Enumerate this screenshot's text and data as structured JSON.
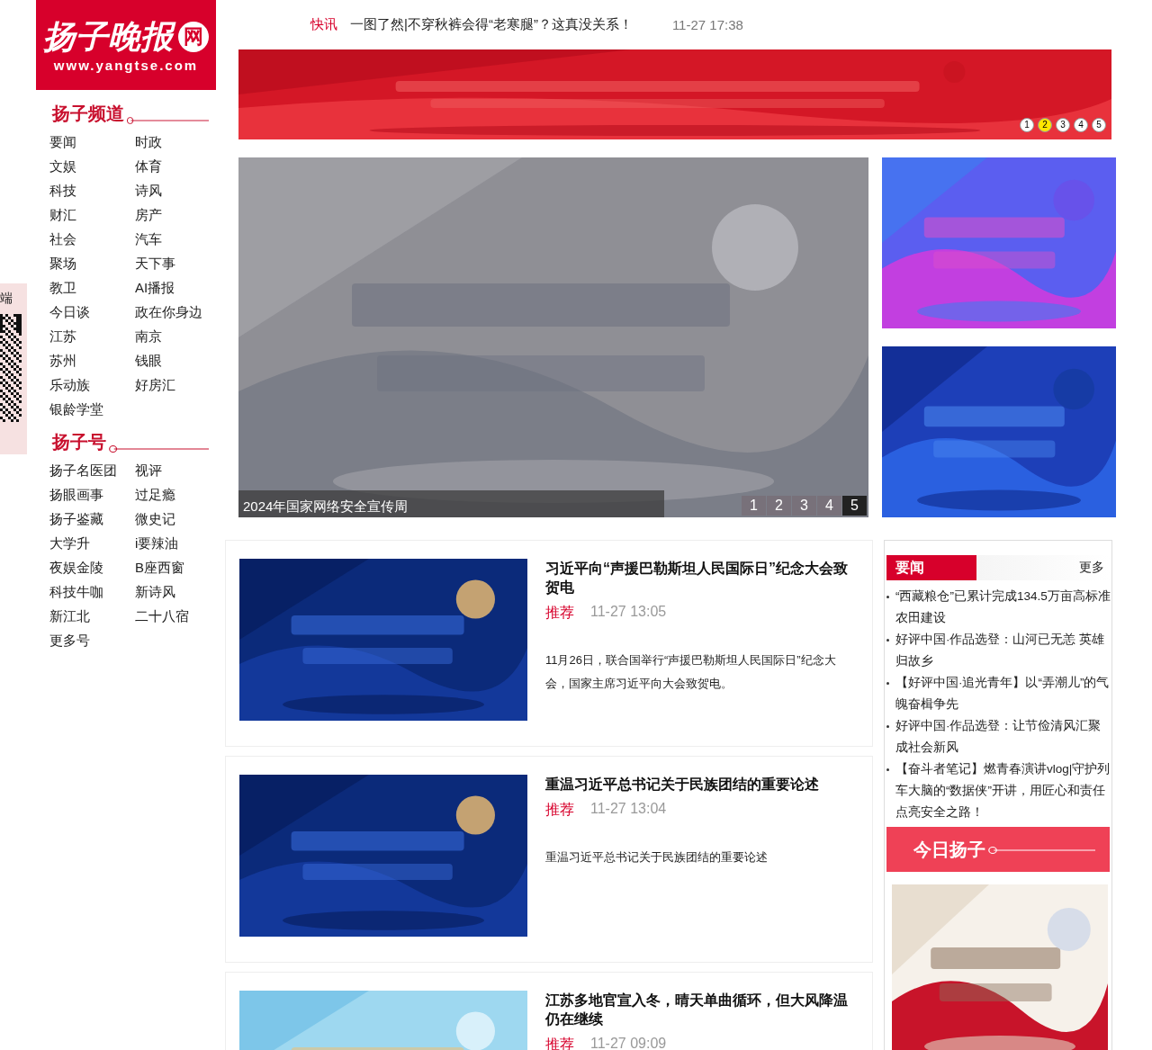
{
  "logo": {
    "name": "扬子晚报",
    "badge": "网",
    "url": "www.yangtse.com"
  },
  "side_qr": {
    "label": "端"
  },
  "channels": {
    "title": "扬子频道",
    "items": [
      "要闻",
      "时政",
      "文娱",
      "体育",
      "科技",
      "诗风",
      "财汇",
      "房产",
      "社会",
      "汽车",
      "聚场",
      "天下事",
      "教卫",
      "AI播报",
      "今日谈",
      "政在你身边",
      "江苏",
      "南京",
      "苏州",
      "钱眼",
      "乐动族",
      "好房汇",
      "银龄学堂"
    ]
  },
  "accounts": {
    "title": "扬子号",
    "items": [
      "扬子名医团",
      "视评",
      "扬眼画事",
      "过足瘾",
      "扬子鉴藏",
      "微史记",
      "大学升",
      "i要辣油",
      "夜娱金陵",
      "B座西窗",
      "科技牛咖",
      "新诗风",
      "新江北",
      "二十八宿",
      "更多号"
    ]
  },
  "ticker": {
    "tag": "快讯",
    "headline": "一图了然|不穿秋裤会得“老寒腿”？这真没关系！",
    "time": "11-27 17:38"
  },
  "top_banner": {
    "pages": [
      {
        "label": "1",
        "selected": false
      },
      {
        "label": "2",
        "selected": true
      },
      {
        "label": "3",
        "selected": false
      },
      {
        "label": "4",
        "selected": false
      },
      {
        "label": "5",
        "selected": false
      }
    ]
  },
  "slider": {
    "caption": "2024年国家网络安全宣传周",
    "pages": [
      {
        "label": "1",
        "selected": false
      },
      {
        "label": "2",
        "selected": false
      },
      {
        "label": "3",
        "selected": false
      },
      {
        "label": "4",
        "selected": false
      },
      {
        "label": "5",
        "selected": true
      }
    ]
  },
  "articles": [
    {
      "title": "习近平向“声援巴勒斯坦人民国际日”纪念大会致贺电",
      "tag": "推荐",
      "time": "11-27 13:05",
      "summary": "11月26日，联合国举行“声援巴勒斯坦人民国际日”纪念大会，国家主席习近平向大会致贺电。"
    },
    {
      "title": "重温习近平总书记关于民族团结的重要论述",
      "tag": "推荐",
      "time": "11-27 13:04",
      "summary": "重温习近平总书记关于民族团结的重要论述"
    },
    {
      "title": "江苏多地官宣入冬，晴天单曲循环，但大风降温仍在继续",
      "tag": "推荐",
      "time": "11-27 09:09"
    }
  ],
  "news_box": {
    "title": "要闻",
    "more": "更多",
    "items": [
      "“西藏粮仓”已累计完成134.5万亩高标准农田建设",
      "好评中国·作品选登：山河已无恙 英雄归故乡",
      "【好评中国·追光青年】以“弄潮儿”的气魄奋楫争先",
      "好评中国·作品选登：让节俭清风汇聚成社会新风",
      "【奋斗者笔记】燃青春演讲vlog|守护列车大脑的“数据侠”开讲，用匠心和责任点亮安全之路！"
    ]
  },
  "today": {
    "title": "今日扬子"
  }
}
